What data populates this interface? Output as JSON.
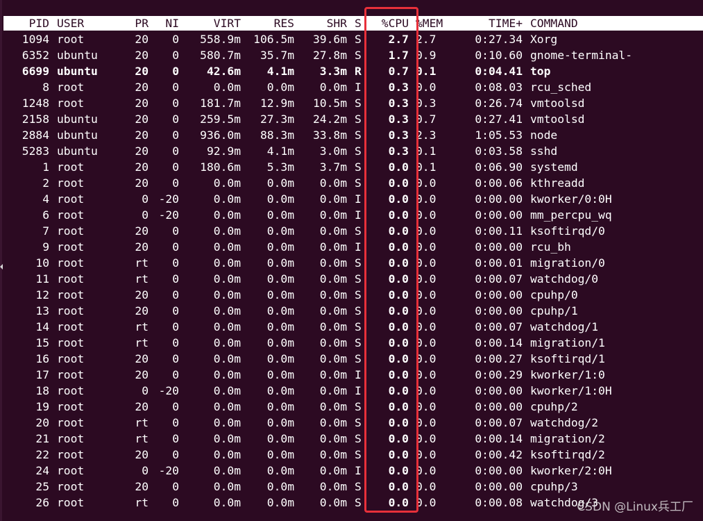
{
  "header": {
    "pid": "PID",
    "user": "USER",
    "pr": "PR",
    "ni": "NI",
    "virt": "VIRT",
    "res": "RES",
    "shr": "SHR",
    "s": "S",
    "cpu": "%CPU",
    "mem": "%MEM",
    "time": "TIME+",
    "command": "COMMAND"
  },
  "processes": [
    {
      "pid": "1094",
      "user": "root",
      "pr": "20",
      "ni": "0",
      "virt": "558.9m",
      "res": "106.5m",
      "shr": "39.6m",
      "s": "S",
      "cpu": "2.7",
      "mem": "2.7",
      "time": "0:27.34",
      "command": "Xorg"
    },
    {
      "pid": "6352",
      "user": "ubuntu",
      "pr": "20",
      "ni": "0",
      "virt": "580.7m",
      "res": "35.7m",
      "shr": "27.8m",
      "s": "S",
      "cpu": "1.7",
      "mem": "0.9",
      "time": "0:10.60",
      "command": "gnome-terminal-"
    },
    {
      "pid": "6699",
      "user": "ubuntu",
      "pr": "20",
      "ni": "0",
      "virt": "42.6m",
      "res": "4.1m",
      "shr": "3.3m",
      "s": "R",
      "cpu": "0.7",
      "mem": "0.1",
      "time": "0:04.41",
      "command": "top"
    },
    {
      "pid": "8",
      "user": "root",
      "pr": "20",
      "ni": "0",
      "virt": "0.0m",
      "res": "0.0m",
      "shr": "0.0m",
      "s": "I",
      "cpu": "0.3",
      "mem": "0.0",
      "time": "0:08.03",
      "command": "rcu_sched"
    },
    {
      "pid": "1248",
      "user": "root",
      "pr": "20",
      "ni": "0",
      "virt": "181.7m",
      "res": "12.9m",
      "shr": "10.5m",
      "s": "S",
      "cpu": "0.3",
      "mem": "0.3",
      "time": "0:26.74",
      "command": "vmtoolsd"
    },
    {
      "pid": "2158",
      "user": "ubuntu",
      "pr": "20",
      "ni": "0",
      "virt": "259.5m",
      "res": "27.3m",
      "shr": "24.2m",
      "s": "S",
      "cpu": "0.3",
      "mem": "0.7",
      "time": "0:27.41",
      "command": "vmtoolsd"
    },
    {
      "pid": "2884",
      "user": "ubuntu",
      "pr": "20",
      "ni": "0",
      "virt": "936.0m",
      "res": "88.3m",
      "shr": "33.8m",
      "s": "S",
      "cpu": "0.3",
      "mem": "2.3",
      "time": "1:05.53",
      "command": "node"
    },
    {
      "pid": "5283",
      "user": "ubuntu",
      "pr": "20",
      "ni": "0",
      "virt": "92.9m",
      "res": "4.1m",
      "shr": "3.0m",
      "s": "S",
      "cpu": "0.3",
      "mem": "0.1",
      "time": "0:03.58",
      "command": "sshd"
    },
    {
      "pid": "1",
      "user": "root",
      "pr": "20",
      "ni": "0",
      "virt": "180.6m",
      "res": "5.3m",
      "shr": "3.7m",
      "s": "S",
      "cpu": "0.0",
      "mem": "0.1",
      "time": "0:06.90",
      "command": "systemd"
    },
    {
      "pid": "2",
      "user": "root",
      "pr": "20",
      "ni": "0",
      "virt": "0.0m",
      "res": "0.0m",
      "shr": "0.0m",
      "s": "S",
      "cpu": "0.0",
      "mem": "0.0",
      "time": "0:00.06",
      "command": "kthreadd"
    },
    {
      "pid": "4",
      "user": "root",
      "pr": "0",
      "ni": "-20",
      "virt": "0.0m",
      "res": "0.0m",
      "shr": "0.0m",
      "s": "I",
      "cpu": "0.0",
      "mem": "0.0",
      "time": "0:00.00",
      "command": "kworker/0:0H"
    },
    {
      "pid": "6",
      "user": "root",
      "pr": "0",
      "ni": "-20",
      "virt": "0.0m",
      "res": "0.0m",
      "shr": "0.0m",
      "s": "I",
      "cpu": "0.0",
      "mem": "0.0",
      "time": "0:00.00",
      "command": "mm_percpu_wq"
    },
    {
      "pid": "7",
      "user": "root",
      "pr": "20",
      "ni": "0",
      "virt": "0.0m",
      "res": "0.0m",
      "shr": "0.0m",
      "s": "S",
      "cpu": "0.0",
      "mem": "0.0",
      "time": "0:00.11",
      "command": "ksoftirqd/0"
    },
    {
      "pid": "9",
      "user": "root",
      "pr": "20",
      "ni": "0",
      "virt": "0.0m",
      "res": "0.0m",
      "shr": "0.0m",
      "s": "I",
      "cpu": "0.0",
      "mem": "0.0",
      "time": "0:00.00",
      "command": "rcu_bh"
    },
    {
      "pid": "10",
      "user": "root",
      "pr": "rt",
      "ni": "0",
      "virt": "0.0m",
      "res": "0.0m",
      "shr": "0.0m",
      "s": "S",
      "cpu": "0.0",
      "mem": "0.0",
      "time": "0:00.01",
      "command": "migration/0"
    },
    {
      "pid": "11",
      "user": "root",
      "pr": "rt",
      "ni": "0",
      "virt": "0.0m",
      "res": "0.0m",
      "shr": "0.0m",
      "s": "S",
      "cpu": "0.0",
      "mem": "0.0",
      "time": "0:00.07",
      "command": "watchdog/0"
    },
    {
      "pid": "12",
      "user": "root",
      "pr": "20",
      "ni": "0",
      "virt": "0.0m",
      "res": "0.0m",
      "shr": "0.0m",
      "s": "S",
      "cpu": "0.0",
      "mem": "0.0",
      "time": "0:00.00",
      "command": "cpuhp/0"
    },
    {
      "pid": "13",
      "user": "root",
      "pr": "20",
      "ni": "0",
      "virt": "0.0m",
      "res": "0.0m",
      "shr": "0.0m",
      "s": "S",
      "cpu": "0.0",
      "mem": "0.0",
      "time": "0:00.00",
      "command": "cpuhp/1"
    },
    {
      "pid": "14",
      "user": "root",
      "pr": "rt",
      "ni": "0",
      "virt": "0.0m",
      "res": "0.0m",
      "shr": "0.0m",
      "s": "S",
      "cpu": "0.0",
      "mem": "0.0",
      "time": "0:00.07",
      "command": "watchdog/1"
    },
    {
      "pid": "15",
      "user": "root",
      "pr": "rt",
      "ni": "0",
      "virt": "0.0m",
      "res": "0.0m",
      "shr": "0.0m",
      "s": "S",
      "cpu": "0.0",
      "mem": "0.0",
      "time": "0:00.14",
      "command": "migration/1"
    },
    {
      "pid": "16",
      "user": "root",
      "pr": "20",
      "ni": "0",
      "virt": "0.0m",
      "res": "0.0m",
      "shr": "0.0m",
      "s": "S",
      "cpu": "0.0",
      "mem": "0.0",
      "time": "0:00.27",
      "command": "ksoftirqd/1"
    },
    {
      "pid": "17",
      "user": "root",
      "pr": "20",
      "ni": "0",
      "virt": "0.0m",
      "res": "0.0m",
      "shr": "0.0m",
      "s": "I",
      "cpu": "0.0",
      "mem": "0.0",
      "time": "0:00.29",
      "command": "kworker/1:0"
    },
    {
      "pid": "18",
      "user": "root",
      "pr": "0",
      "ni": "-20",
      "virt": "0.0m",
      "res": "0.0m",
      "shr": "0.0m",
      "s": "I",
      "cpu": "0.0",
      "mem": "0.0",
      "time": "0:00.00",
      "command": "kworker/1:0H"
    },
    {
      "pid": "19",
      "user": "root",
      "pr": "20",
      "ni": "0",
      "virt": "0.0m",
      "res": "0.0m",
      "shr": "0.0m",
      "s": "S",
      "cpu": "0.0",
      "mem": "0.0",
      "time": "0:00.00",
      "command": "cpuhp/2"
    },
    {
      "pid": "20",
      "user": "root",
      "pr": "rt",
      "ni": "0",
      "virt": "0.0m",
      "res": "0.0m",
      "shr": "0.0m",
      "s": "S",
      "cpu": "0.0",
      "mem": "0.0",
      "time": "0:00.07",
      "command": "watchdog/2"
    },
    {
      "pid": "21",
      "user": "root",
      "pr": "rt",
      "ni": "0",
      "virt": "0.0m",
      "res": "0.0m",
      "shr": "0.0m",
      "s": "S",
      "cpu": "0.0",
      "mem": "0.0",
      "time": "0:00.14",
      "command": "migration/2"
    },
    {
      "pid": "22",
      "user": "root",
      "pr": "20",
      "ni": "0",
      "virt": "0.0m",
      "res": "0.0m",
      "shr": "0.0m",
      "s": "S",
      "cpu": "0.0",
      "mem": "0.0",
      "time": "0:00.42",
      "command": "ksoftirqd/2"
    },
    {
      "pid": "24",
      "user": "root",
      "pr": "0",
      "ni": "-20",
      "virt": "0.0m",
      "res": "0.0m",
      "shr": "0.0m",
      "s": "I",
      "cpu": "0.0",
      "mem": "0.0",
      "time": "0:00.00",
      "command": "kworker/2:0H"
    },
    {
      "pid": "25",
      "user": "root",
      "pr": "20",
      "ni": "0",
      "virt": "0.0m",
      "res": "0.0m",
      "shr": "0.0m",
      "s": "S",
      "cpu": "0.0",
      "mem": "0.0",
      "time": "0:00.00",
      "command": "cpuhp/3"
    },
    {
      "pid": "26",
      "user": "root",
      "pr": "rt",
      "ni": "0",
      "virt": "0.0m",
      "res": "0.0m",
      "shr": "0.0m",
      "s": "S",
      "cpu": "0.0",
      "mem": "0.0",
      "time": "0:00.08",
      "command": "watchdog/3"
    }
  ],
  "highlighted_process_pid": "6699",
  "watermark": "CSDN @Linux兵工厂",
  "colors": {
    "terminal_background": "#2c0a22",
    "text": "#ffffff",
    "header_background": "#ffffff",
    "highlight_box": "#e8303a"
  }
}
